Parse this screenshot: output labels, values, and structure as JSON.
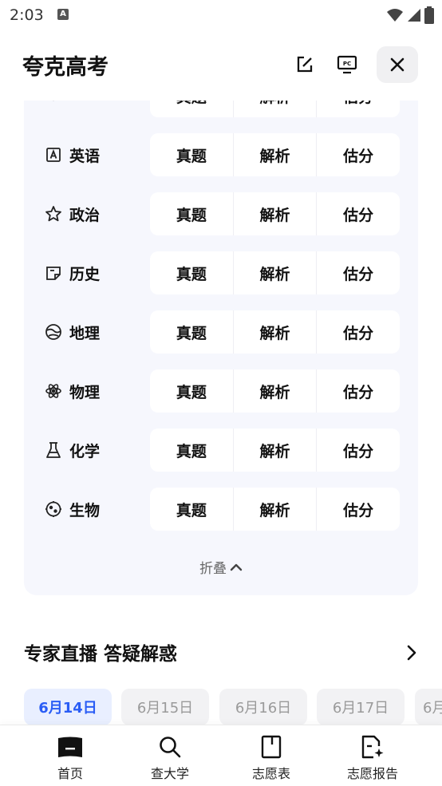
{
  "status_bar": {
    "time": "2:03",
    "notification_badge": "A"
  },
  "header": {
    "title": "夸克高考"
  },
  "subjects": {
    "partial_row": {
      "btn1": "真题",
      "btn2": "解析",
      "btn3": "估分"
    },
    "rows": [
      {
        "name": "英语",
        "icon": "letter-a-icon",
        "btn1": "真题",
        "btn2": "解析",
        "btn3": "估分"
      },
      {
        "name": "政治",
        "icon": "star-icon",
        "btn1": "真题",
        "btn2": "解析",
        "btn3": "估分"
      },
      {
        "name": "历史",
        "icon": "book-icon",
        "btn1": "真题",
        "btn2": "解析",
        "btn3": "估分"
      },
      {
        "name": "地理",
        "icon": "globe-icon",
        "btn1": "真题",
        "btn2": "解析",
        "btn3": "估分"
      },
      {
        "name": "物理",
        "icon": "atom-icon",
        "btn1": "真题",
        "btn2": "解析",
        "btn3": "估分"
      },
      {
        "name": "化学",
        "icon": "flask-icon",
        "btn1": "真题",
        "btn2": "解析",
        "btn3": "估分"
      },
      {
        "name": "生物",
        "icon": "cell-icon",
        "btn1": "真题",
        "btn2": "解析",
        "btn3": "估分"
      }
    ],
    "collapse_label": "折叠"
  },
  "live_section": {
    "title": "专家直播 答疑解惑",
    "dates": [
      "6月14日",
      "6月15日",
      "6月16日",
      "6月17日",
      "6月"
    ],
    "active_index": 0
  },
  "bottom_nav": [
    {
      "label": "首页",
      "icon": "book-open-icon"
    },
    {
      "label": "查大学",
      "icon": "search-icon"
    },
    {
      "label": "志愿表",
      "icon": "bookmark-icon"
    },
    {
      "label": "志愿报告",
      "icon": "report-sparkle-icon"
    }
  ],
  "colors": {
    "accent": "#2a5df5",
    "card_bg": "#f6f7fd"
  }
}
